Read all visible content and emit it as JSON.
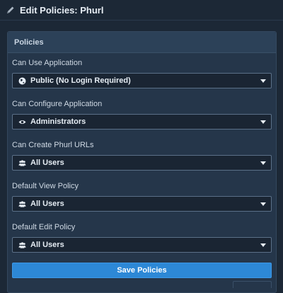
{
  "header": {
    "title": "Edit Policies: Phurl",
    "icon": "pencil-icon"
  },
  "panel": {
    "heading": "Policies",
    "fields": [
      {
        "label": "Can Use Application",
        "value": "Public (No Login Required)",
        "icon": "globe-icon"
      },
      {
        "label": "Can Configure Application",
        "value": "Administrators",
        "icon": "eye-icon"
      },
      {
        "label": "Can Create Phurl URLs",
        "value": "All Users",
        "icon": "users-icon"
      },
      {
        "label": "Default View Policy",
        "value": "All Users",
        "icon": "users-icon"
      },
      {
        "label": "Default Edit Policy",
        "value": "All Users",
        "icon": "users-icon"
      }
    ],
    "save_label": "Save Policies"
  },
  "colors": {
    "background": "#1c2836",
    "panel": "#25364a",
    "panel_heading": "#2c4158",
    "select_bg": "#1a2533",
    "primary_button": "#2d88d6"
  }
}
